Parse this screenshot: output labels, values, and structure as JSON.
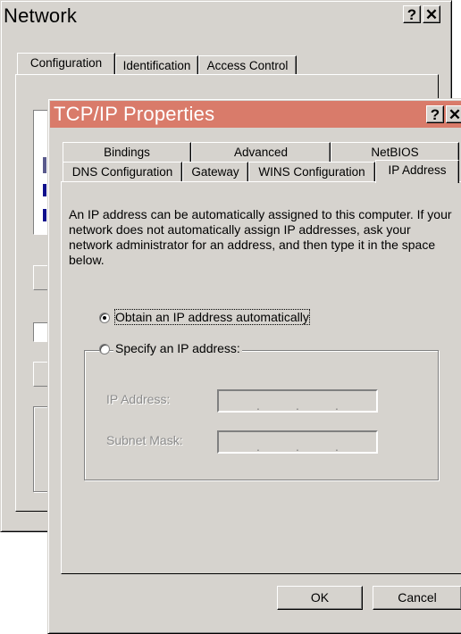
{
  "network": {
    "title": "Network",
    "help_glyph": "?",
    "close_glyph": "✕",
    "tabs": [
      "Configuration",
      "Identification",
      "Access Control"
    ]
  },
  "tcpip": {
    "title": "TCP/IP Properties",
    "help_glyph": "?",
    "close_glyph": "✕",
    "tabs_back": [
      "Bindings",
      "Advanced",
      "NetBIOS"
    ],
    "tabs_front": [
      "DNS Configuration",
      "Gateway",
      "WINS Configuration",
      "IP Address"
    ],
    "description": "An IP address can be automatically assigned to this computer. If your network does not automatically assign IP addresses, ask your network administrator for an address, and then type it in the space below.",
    "option_auto": "Obtain an IP address automatically",
    "option_specify": "Specify an IP address:",
    "ip_label": "IP Address:",
    "mask_label": "Subnet Mask:",
    "ok_label": "OK",
    "cancel_label": "Cancel",
    "selected_option": "auto"
  }
}
